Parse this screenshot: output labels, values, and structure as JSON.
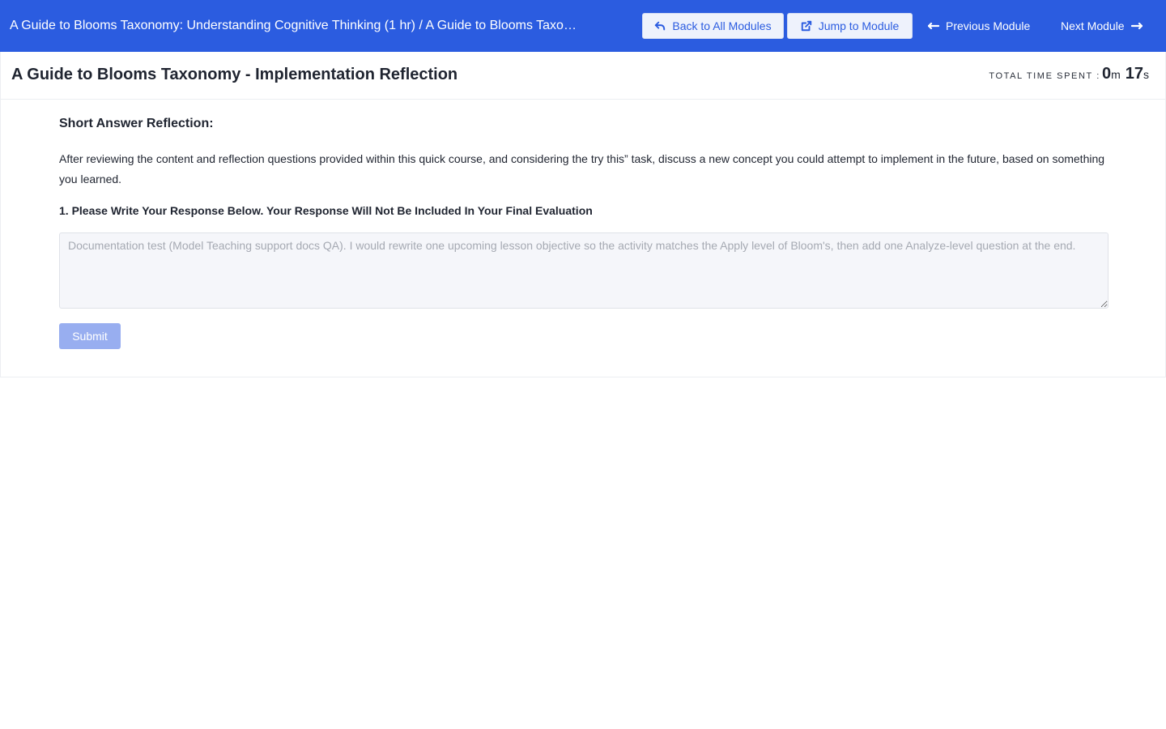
{
  "header": {
    "breadcrumb": "A Guide to Blooms Taxonomy: Understanding Cognitive Thinking (1 hr) / A Guide to Blooms Taxonomy - Implementation Reflection",
    "back_label": "Back to All Modules",
    "jump_label": "Jump to Module",
    "prev_label": "Previous Module",
    "next_label": "Next Module",
    "accent_color": "#2b5ce0"
  },
  "page": {
    "title": "A Guide to Blooms Taxonomy - Implementation Reflection",
    "timer": {
      "label": "TOTAL TIME SPENT :",
      "minutes": "0",
      "minutes_unit": "m",
      "seconds": "17",
      "seconds_unit": "s"
    }
  },
  "content": {
    "section_title": "Short Answer Reflection:",
    "description": "After reviewing the content and reflection questions provided within this quick course, and considering the try this” task, discuss a new concept you could attempt to implement in the future, based on something you learned.",
    "question": "1. Please Write Your Response Below. Your Response Will Not Be Included In Your Final Evaluation",
    "answer_placeholder": "Documentation test (Model Teaching support docs QA). I would rewrite one upcoming lesson objective so the activity matches the Apply level of Bloom's, then add one Analyze-level question at the end.",
    "answer_value": "",
    "submit_label": "Submit"
  },
  "icons": {
    "back": "reply-arrow-icon",
    "jump": "external-link-icon",
    "prev": "arrow-left-icon",
    "next": "arrow-right-icon"
  }
}
